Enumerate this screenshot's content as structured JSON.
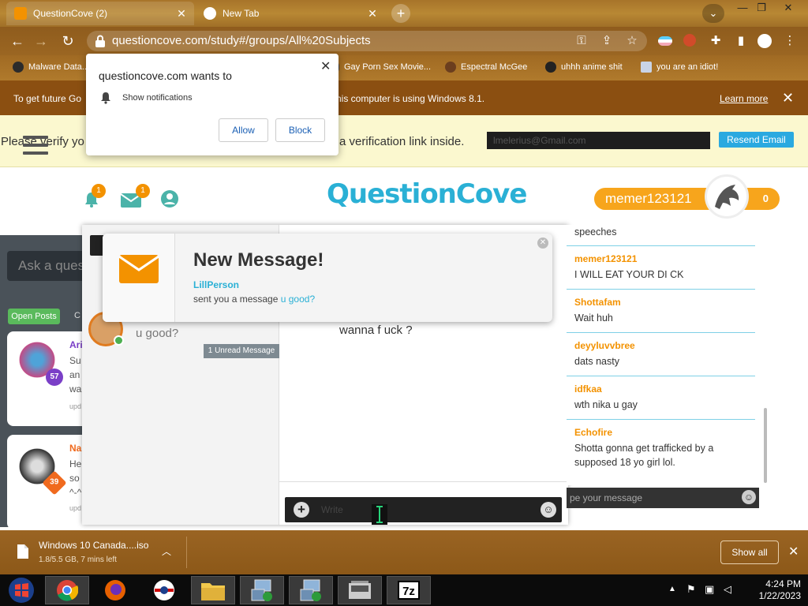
{
  "browser": {
    "tabs": [
      {
        "title": "QuestionCove (2)",
        "active": true
      },
      {
        "title": "New Tab",
        "active": false
      }
    ],
    "new_tab_symbol": "+",
    "url": "questioncove.com/study#/groups/All%20Subjects",
    "bookmarks": [
      {
        "label": "Malware Data..."
      },
      {
        "label": "Gay Porn Sex Movie..."
      },
      {
        "label": "Espectral McGee"
      },
      {
        "label": "uhhh anime shit"
      },
      {
        "label": "you are an idiot!"
      }
    ],
    "theme_colors": {
      "tabbar": "#a7742a",
      "toolbar": "#9b6622",
      "banner": "#8b4f11"
    }
  },
  "win_banner": {
    "text_left": "To get future Go",
    "text_right": "his computer is using Windows 8.1.",
    "learn_more": "Learn more",
    "close": "✕"
  },
  "permission_popup": {
    "title": "questioncove.com wants to",
    "permission": "Show notifications",
    "allow": "Allow",
    "block": "Block",
    "close": "✕"
  },
  "verify": {
    "text_left": "Please verify yo",
    "text_right": "a verification link inside.",
    "email_value": "lmelerius@Gmail.com",
    "resend": "Resend Email"
  },
  "header": {
    "notif_count": "1",
    "mail_count": "1",
    "logo": "QuestionCove",
    "username": "memer123121",
    "points": "0",
    "accent": "#f39200",
    "brand": "#2ab0d5"
  },
  "sidebar": {
    "ask_placeholder": "Ask a ques",
    "open_posts": "Open Posts",
    "tab_c": "C",
    "posts": [
      {
        "name": "Ari",
        "level": "57",
        "lines": [
          "Su",
          "an",
          "wa"
        ],
        "meta": "upd"
      },
      {
        "name": "Na",
        "level": "39",
        "lines": [
          "He",
          "so",
          "^-^"
        ],
        "meta": "upd"
      }
    ]
  },
  "chat": {
    "conv_preview": "u good?",
    "unread": "1 Unread Message",
    "message_body": "wanna f uck ?",
    "composer_placeholder": "Write"
  },
  "new_message": {
    "title": "New Message!",
    "sender": "LillPerson",
    "text": "sent you a message",
    "snippet": "u good?"
  },
  "feed": {
    "items": [
      {
        "user": "",
        "msg": "speeches"
      },
      {
        "user": "memer123121",
        "msg": "I WILL EAT YOUR DI CK"
      },
      {
        "user": "Shottafam",
        "msg": "Wait huh"
      },
      {
        "user": "deyyluvvbree",
        "msg": "dats nasty"
      },
      {
        "user": "idfkaa",
        "msg": "wth nika u gay"
      },
      {
        "user": "Echofire",
        "msg": "Shotta gonna get trafficked by a supposed 18 yo girl lol."
      }
    ],
    "input_placeholder": "pe your message"
  },
  "download": {
    "filename": "Windows 10 Canada....iso",
    "progress": "1.8/5.5 GB, 7 mins left",
    "show_all": "Show all"
  },
  "taskbar": {
    "time": "4:24 PM",
    "date": "1/22/2023",
    "zip_label": "7z"
  }
}
